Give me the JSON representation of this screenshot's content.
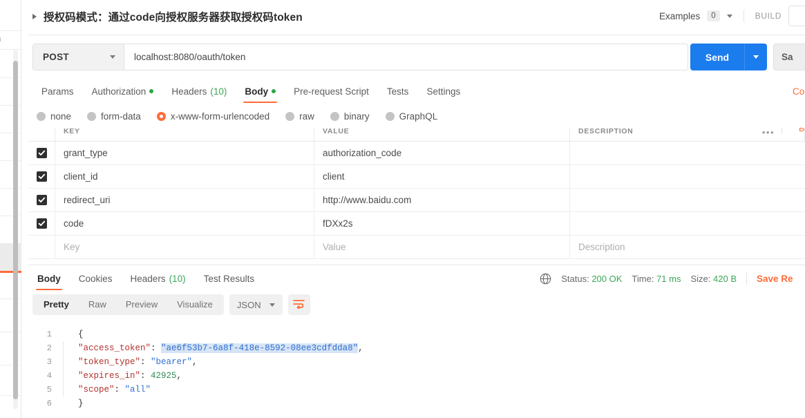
{
  "sidebar": {
    "clipped_text": "h"
  },
  "request": {
    "title": "授权码模式：通过code向授权服务器获取授权码token",
    "expand_icon": "triangle-right-icon",
    "examples_label": "Examples",
    "examples_count": "0",
    "build_label": "BUILD",
    "method": "POST",
    "url": "localhost:8080/oauth/token",
    "send_label": "Send",
    "save_label": "Sa",
    "cookies_link": "Coo",
    "tabs": [
      {
        "label": "Params",
        "dot": false,
        "count": null,
        "active": false
      },
      {
        "label": "Authorization",
        "dot": true,
        "count": null,
        "active": false
      },
      {
        "label": "Headers",
        "dot": false,
        "count": "(10)",
        "active": false
      },
      {
        "label": "Body",
        "dot": true,
        "count": null,
        "active": true
      },
      {
        "label": "Pre-request Script",
        "dot": false,
        "count": null,
        "active": false
      },
      {
        "label": "Tests",
        "dot": false,
        "count": null,
        "active": false
      },
      {
        "label": "Settings",
        "dot": false,
        "count": null,
        "active": false
      }
    ],
    "body_types": [
      {
        "label": "none",
        "selected": false
      },
      {
        "label": "form-data",
        "selected": false
      },
      {
        "label": "x-www-form-urlencoded",
        "selected": true
      },
      {
        "label": "raw",
        "selected": false
      },
      {
        "label": "binary",
        "selected": false
      },
      {
        "label": "GraphQL",
        "selected": false
      }
    ],
    "table": {
      "headers": {
        "key": "KEY",
        "value": "VALUE",
        "description": "DESCRIPTION"
      },
      "menu_icon": "•••",
      "bulk_edit_label": "B",
      "rows": [
        {
          "checked": true,
          "key": "grant_type",
          "value": "authorization_code",
          "description": ""
        },
        {
          "checked": true,
          "key": "client_id",
          "value": "client",
          "description": ""
        },
        {
          "checked": true,
          "key": "redirect_uri",
          "value": "http://www.baidu.com",
          "description": ""
        },
        {
          "checked": true,
          "key": "code",
          "value": "fDXx2s",
          "description": ""
        }
      ],
      "placeholder_row": {
        "key": "Key",
        "value": "Value",
        "description": "Description"
      }
    }
  },
  "response": {
    "tabs": [
      {
        "label": "Body",
        "count": null,
        "active": true
      },
      {
        "label": "Cookies",
        "count": null,
        "active": false
      },
      {
        "label": "Headers",
        "count": "(10)",
        "active": false
      },
      {
        "label": "Test Results",
        "count": null,
        "active": false
      }
    ],
    "globe_icon": "globe-icon",
    "status_label": "Status:",
    "status_value": "200 OK",
    "time_label": "Time:",
    "time_value": "71 ms",
    "size_label": "Size:",
    "size_value": "420 B",
    "save_response_label": "Save Re",
    "format_tabs": [
      {
        "label": "Pretty",
        "active": true
      },
      {
        "label": "Raw",
        "active": false
      },
      {
        "label": "Preview",
        "active": false
      },
      {
        "label": "Visualize",
        "active": false
      }
    ],
    "language": "JSON",
    "wrap_icon": "word-wrap-icon",
    "code_lines": [
      {
        "no": "1",
        "guide": false,
        "segments": [
          {
            "t": "{",
            "c": "p"
          }
        ]
      },
      {
        "no": "2",
        "guide": true,
        "segments": [
          {
            "t": "    ",
            "c": "p"
          },
          {
            "t": "\"access_token\"",
            "c": "k"
          },
          {
            "t": ": ",
            "c": "p"
          },
          {
            "t": "\"ae6f53b7-6a8f-418e-8592-08ee3cdfdda8\"",
            "c": "s sel"
          },
          {
            "t": ",",
            "c": "p"
          }
        ]
      },
      {
        "no": "3",
        "guide": true,
        "segments": [
          {
            "t": "    ",
            "c": "p"
          },
          {
            "t": "\"token_type\"",
            "c": "k"
          },
          {
            "t": ": ",
            "c": "p"
          },
          {
            "t": "\"bearer\"",
            "c": "s"
          },
          {
            "t": ",",
            "c": "p"
          }
        ]
      },
      {
        "no": "4",
        "guide": true,
        "segments": [
          {
            "t": "    ",
            "c": "p"
          },
          {
            "t": "\"expires_in\"",
            "c": "k"
          },
          {
            "t": ": ",
            "c": "p"
          },
          {
            "t": "42925",
            "c": "n"
          },
          {
            "t": ",",
            "c": "p"
          }
        ]
      },
      {
        "no": "5",
        "guide": true,
        "segments": [
          {
            "t": "    ",
            "c": "p"
          },
          {
            "t": "\"scope\"",
            "c": "k"
          },
          {
            "t": ": ",
            "c": "p"
          },
          {
            "t": "\"all\"",
            "c": "s"
          }
        ]
      },
      {
        "no": "6",
        "guide": false,
        "segments": [
          {
            "t": "}",
            "c": "p"
          }
        ]
      }
    ]
  },
  "colors": {
    "accent_orange": "#ff6c37",
    "send_blue": "#1b7ced",
    "status_green": "#3aa757",
    "dot_green": "#28a745"
  }
}
